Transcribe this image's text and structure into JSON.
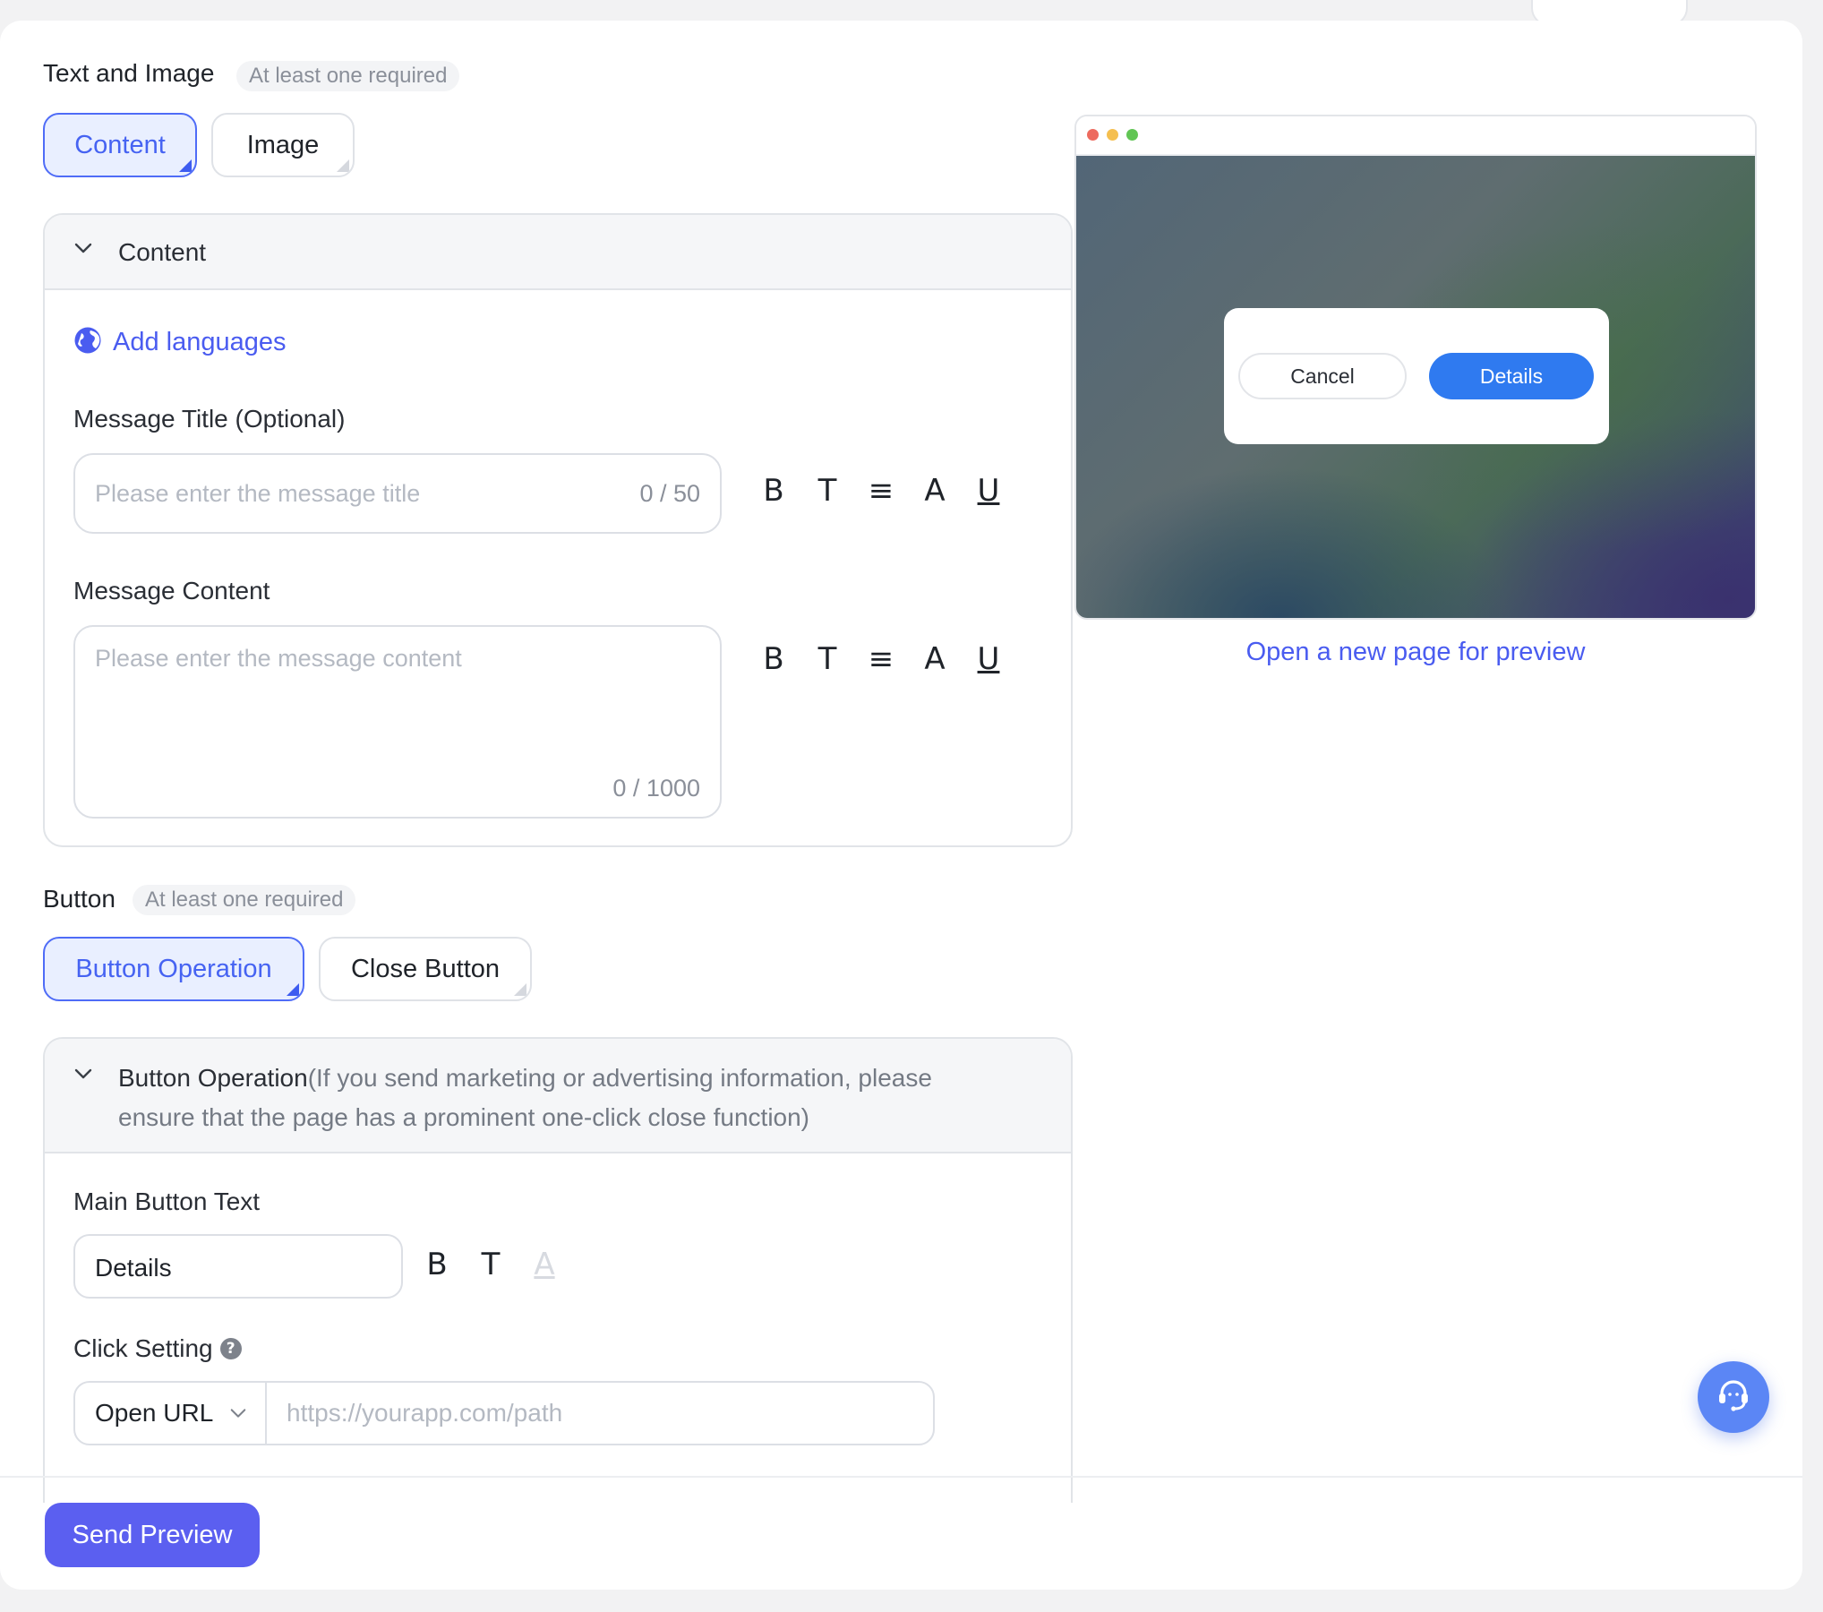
{
  "text_image": {
    "title": "Text and Image",
    "required_tag": "At least one required",
    "tabs": [
      {
        "label": "Content",
        "active": true
      },
      {
        "label": "Image",
        "active": false
      }
    ]
  },
  "content_panel": {
    "header": "Content",
    "add_languages": "Add languages",
    "title_field": {
      "label": "Message Title (Optional)",
      "placeholder": "Please enter the message title",
      "counter": "0 / 50"
    },
    "content_field": {
      "label": "Message Content",
      "placeholder": "Please enter the message content",
      "counter": "0 / 1000"
    },
    "format_tools": [
      "B",
      "T",
      "≡",
      "A",
      "U"
    ]
  },
  "button_section": {
    "title": "Button",
    "required_tag": "At least one required",
    "tabs": [
      {
        "label": "Button Operation",
        "active": true
      },
      {
        "label": "Close Button",
        "active": false
      }
    ]
  },
  "button_panel": {
    "header_main": "Button Operation",
    "header_note_line1": "(If you send marketing or advertising information, please",
    "header_note_line2": "ensure that the page has a prominent one-click close function)",
    "main_button_text_label": "Main Button Text",
    "main_button_text_value": "Details",
    "format_tools": [
      "B",
      "T",
      "A"
    ],
    "click_setting_label": "Click Setting",
    "click_setting_help": "?",
    "action_select": "Open URL",
    "url_placeholder": "https://yourapp.com/path"
  },
  "preview": {
    "dialog_cancel": "Cancel",
    "dialog_details": "Details",
    "open_new_page": "Open a new page for preview",
    "window_dots": [
      "#ed6a5e",
      "#f5bf4f",
      "#61c554"
    ]
  },
  "footer": {
    "send_preview": "Send Preview"
  },
  "colors": {
    "accent": "#4a5cf0",
    "primary_button": "#5b5ff0",
    "dialog_primary": "#2f7af0",
    "support_button": "#5b86f5"
  },
  "icons": {
    "globe": "globe-icon",
    "chevron": "chevron-down-icon",
    "help": "help-circle-icon",
    "support": "headset-icon"
  }
}
